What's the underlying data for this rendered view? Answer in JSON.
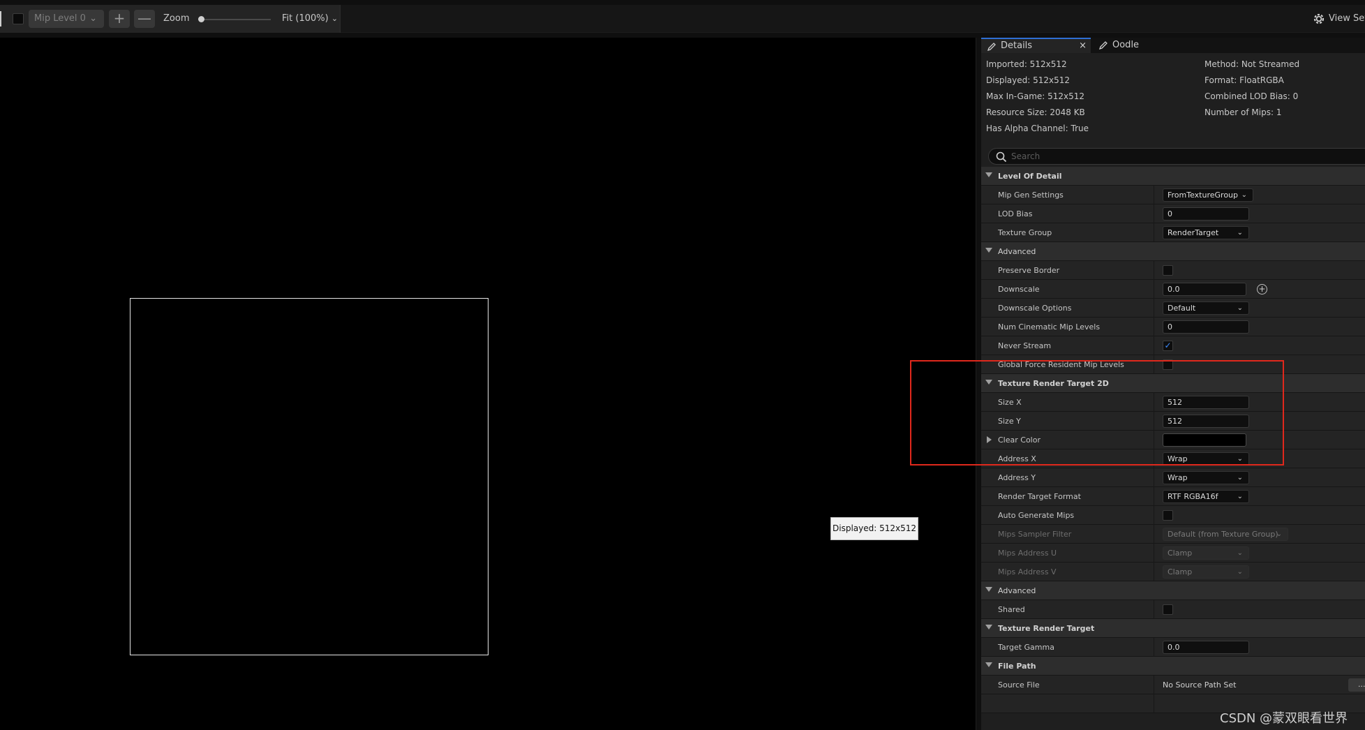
{
  "toolbar": {
    "mip_level": "Mip Level 0",
    "zoom_label": "Zoom",
    "zoom_value": 0.0,
    "fit_label": "Fit (100%)",
    "view_settings": "View Set",
    "plus_label": "+",
    "minus_label": "—"
  },
  "viewport": {
    "tooltip": "Displayed: 512x512"
  },
  "tabs": [
    {
      "label": "Details",
      "close": "×"
    },
    {
      "label": "Oodle"
    }
  ],
  "info": {
    "left": [
      "Imported: 512x512",
      "Displayed: 512x512",
      "Max In-Game: 512x512",
      "Resource Size: 2048 KB",
      "Has Alpha Channel: True"
    ],
    "right": [
      "Method: Not Streamed",
      "Format: FloatRGBA",
      "Combined LOD Bias: 0",
      "Number of Mips: 1"
    ]
  },
  "search": {
    "placeholder": "Search"
  },
  "properties": {
    "lod_section": "Level Of Detail",
    "mip_gen_settings": {
      "label": "Mip Gen Settings",
      "value": "FromTextureGroup"
    },
    "lod_bias": {
      "label": "LOD Bias",
      "value": "0"
    },
    "texture_group": {
      "label": "Texture Group",
      "value": "RenderTarget"
    },
    "advanced_1": "Advanced",
    "preserve_border": {
      "label": "Preserve Border",
      "checked": false
    },
    "downscale": {
      "label": "Downscale",
      "value": "0.0"
    },
    "downscale_options": {
      "label": "Downscale Options",
      "value": "Default"
    },
    "num_cinematic_mip_levels": {
      "label": "Num Cinematic Mip Levels",
      "value": "0"
    },
    "never_stream": {
      "label": "Never Stream",
      "checked": true,
      "check_glyph": "✓"
    },
    "global_force_resident": {
      "label": "Global Force Resident Mip Levels",
      "checked": false
    },
    "trt2d_section": "Texture Render Target 2D",
    "size_x": {
      "label": "Size X",
      "value": "512"
    },
    "size_y": {
      "label": "Size Y",
      "value": "512"
    },
    "clear_color": {
      "label": "Clear Color",
      "value": "#000000"
    },
    "address_x": {
      "label": "Address X",
      "value": "Wrap"
    },
    "address_y": {
      "label": "Address Y",
      "value": "Wrap"
    },
    "render_target_format": {
      "label": "Render Target Format",
      "value": "RTF RGBA16f"
    },
    "auto_generate_mips": {
      "label": "Auto Generate Mips",
      "checked": false
    },
    "mips_sampler_filter": {
      "label": "Mips Sampler Filter",
      "value": "Default (from Texture Group)"
    },
    "mips_address_u": {
      "label": "Mips Address U",
      "value": "Clamp"
    },
    "mips_address_v": {
      "label": "Mips Address V",
      "value": "Clamp"
    },
    "advanced_2": "Advanced",
    "shared": {
      "label": "Shared",
      "checked": false
    },
    "trt_section": "Texture Render Target",
    "target_gamma": {
      "label": "Target Gamma",
      "value": "0.0"
    },
    "file_path_section": "File Path",
    "source_file": {
      "label": "Source File",
      "value": "No Source Path Set",
      "button": "..."
    }
  },
  "watermark": "CSDN @蒙双眼看世界",
  "colors": {
    "highlight": "#e0281c",
    "accent": "#2f6fd4",
    "checked": "#3d8cff"
  }
}
